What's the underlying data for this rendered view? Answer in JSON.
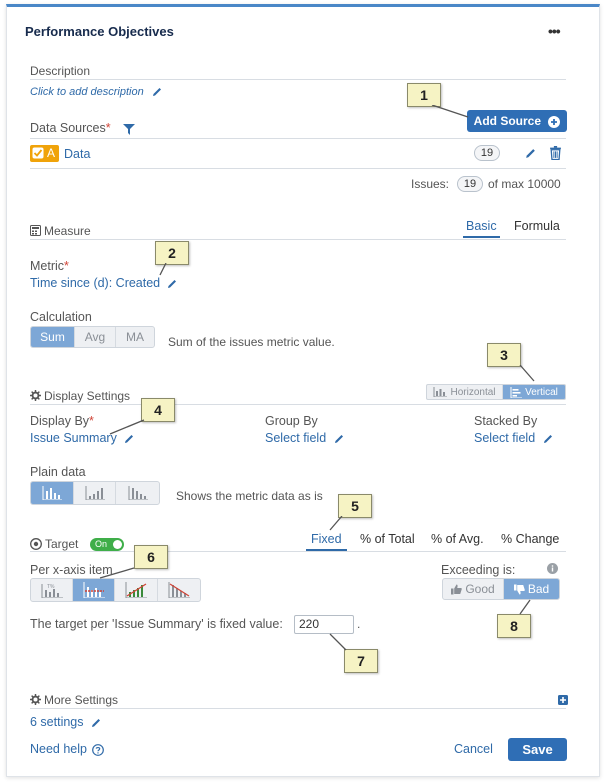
{
  "panel": {
    "title": "Performance Objectives",
    "menu_glyph": "•••"
  },
  "description": {
    "label": "Description",
    "placeholder_link": "Click to add description"
  },
  "data_sources": {
    "label": "Data Sources",
    "required_mark": "*",
    "add_button": "Add Source",
    "source_prefix": "A",
    "source_name": "Data",
    "source_count": "19",
    "issues_label": "Issues:",
    "issues_count": "19",
    "issues_max": "of max 10000"
  },
  "measure": {
    "section_label": "Measure",
    "tabs": [
      {
        "label": "Basic",
        "active": true
      },
      {
        "label": "Formula",
        "active": false
      }
    ],
    "metric_label": "Metric",
    "required_mark": "*",
    "metric_value": "Time since (d): Created",
    "calculation_label": "Calculation",
    "calculation_options": [
      {
        "label": "Sum",
        "active": true
      },
      {
        "label": "Avg",
        "active": false
      },
      {
        "label": "MA",
        "active": false
      }
    ],
    "calculation_desc": "Sum of the issues metric value."
  },
  "display": {
    "section_label": "Display Settings",
    "orientation": [
      {
        "label": "Horizontal",
        "active": false
      },
      {
        "label": "Vertical",
        "active": true
      }
    ],
    "display_by_label": "Display By",
    "required_mark": "*",
    "display_by_value": "Issue Summary",
    "group_by_label": "Group By",
    "group_by_value": "Select field",
    "stacked_by_label": "Stacked By",
    "stacked_by_value": "Select field",
    "plain_data_label": "Plain data",
    "plain_data_desc": "Shows the metric data as is"
  },
  "target": {
    "section_label": "Target",
    "toggle_label": "On",
    "tabs": [
      {
        "label": "Fixed",
        "active": true
      },
      {
        "label": "% of Total",
        "active": false
      },
      {
        "label": "% of Avg.",
        "active": false
      },
      {
        "label": "% Change",
        "active": false
      }
    ],
    "per_item_label": "Per x-axis item",
    "exceeding_label": "Exceeding is:",
    "good_label": "Good",
    "bad_label": "Bad",
    "fixed_text": "The target per 'Issue Summary' is fixed value:",
    "fixed_value": "220",
    "fixed_suffix": "."
  },
  "more_settings": {
    "section_label": "More Settings",
    "settings_link": "6 settings"
  },
  "footer": {
    "help_label": "Need help",
    "cancel_label": "Cancel",
    "save_label": "Save"
  },
  "callouts": [
    "1",
    "2",
    "3",
    "4",
    "5",
    "6",
    "7",
    "8"
  ],
  "colors": {
    "accent": "#2f6eb5",
    "link": "#2f6aa8",
    "toggle_on": "#3fae49",
    "callout_bg": "#f6f3c4",
    "source_badge": "#f0a30a"
  }
}
